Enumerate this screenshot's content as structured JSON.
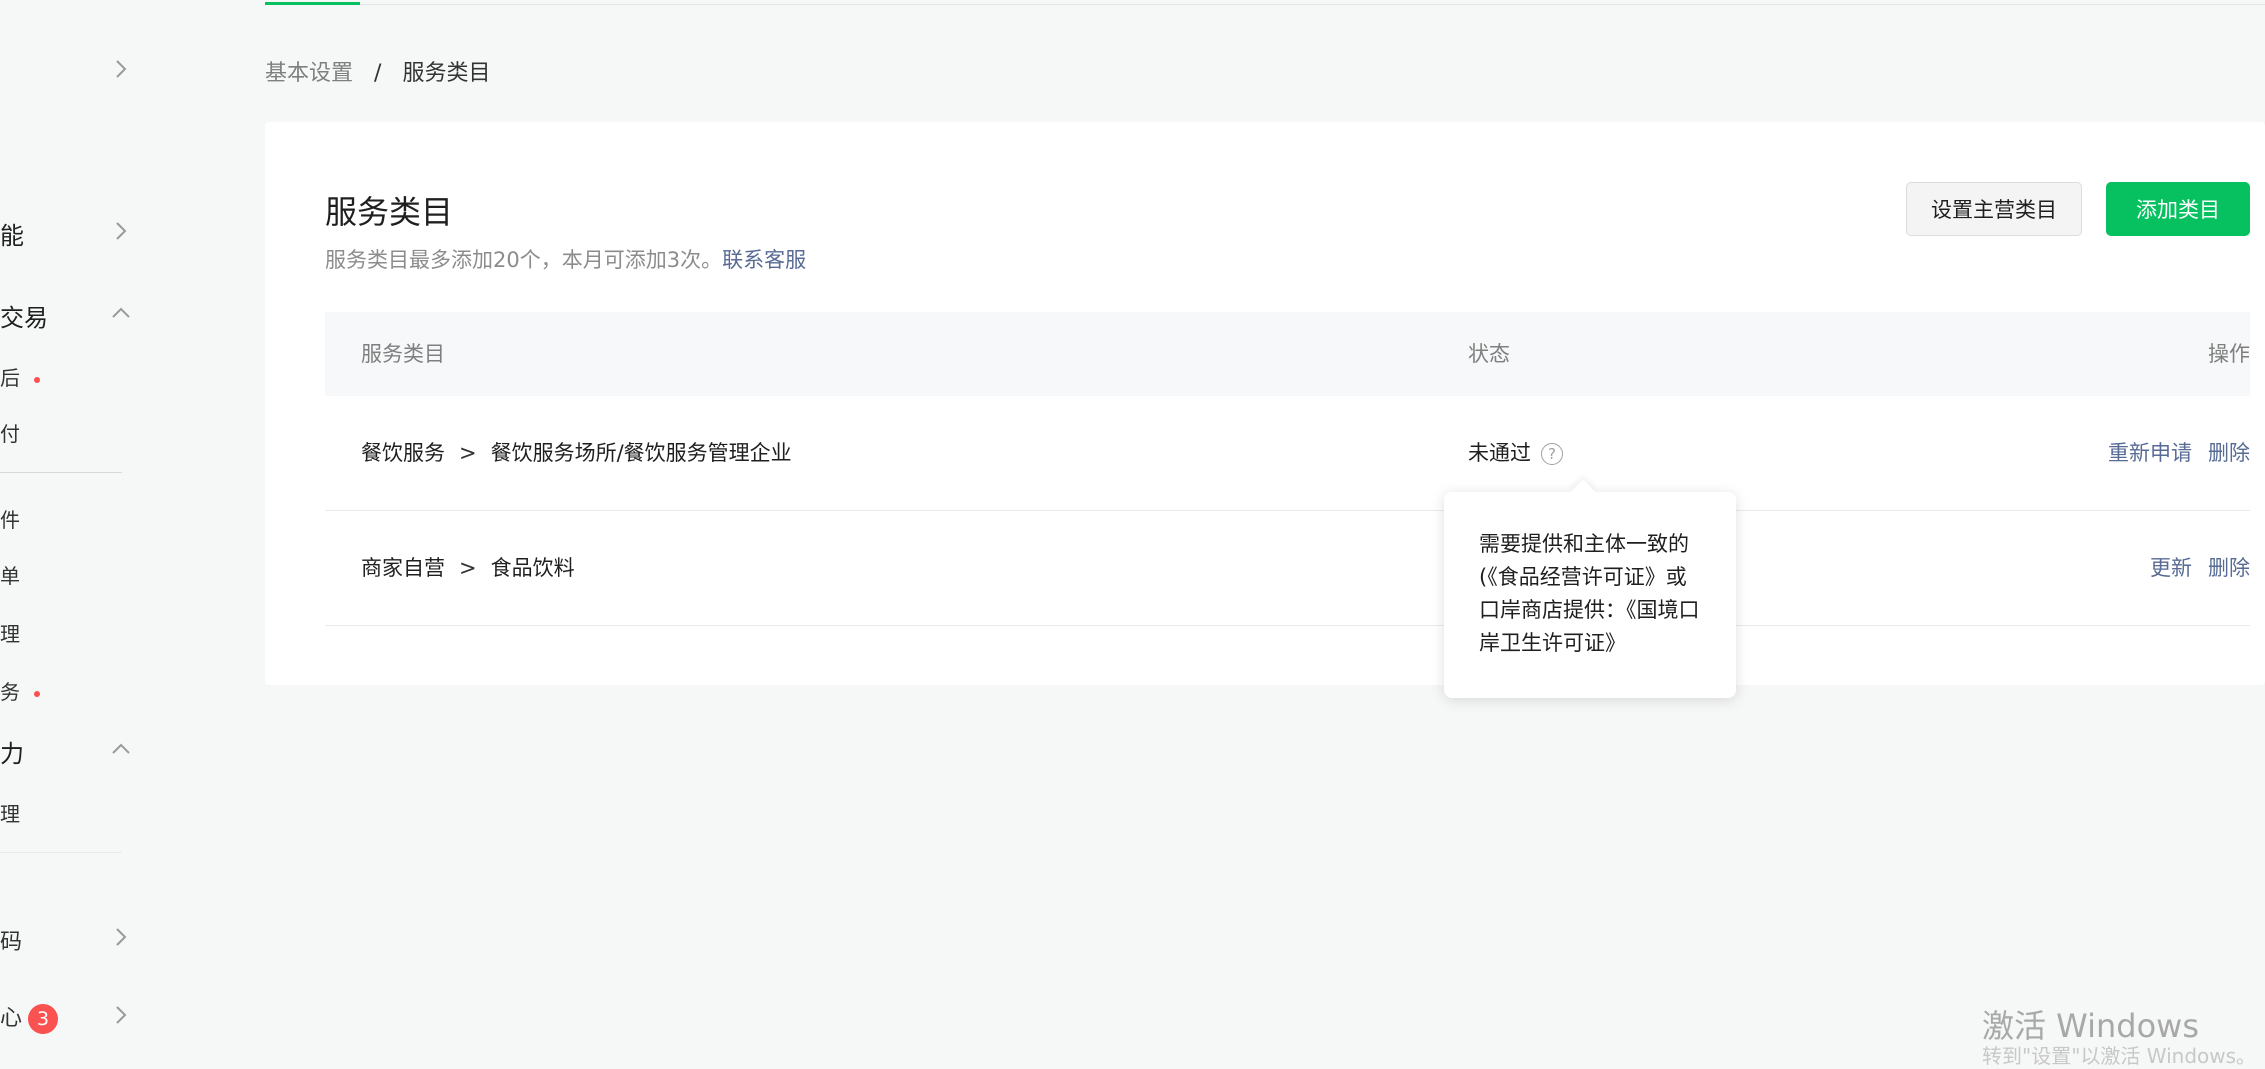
{
  "sidebar": {
    "items": [
      {
        "label": "能",
        "chevron": "up"
      },
      {
        "label": "交易",
        "chevron": "down"
      },
      {
        "label": "力",
        "chevron": "down"
      },
      {
        "label": "码",
        "chevron": "right"
      },
      {
        "label": "心",
        "chevron": "right",
        "badge": "3"
      }
    ],
    "sub_items": [
      "后",
      "付",
      "件",
      "单",
      "理",
      "务",
      "理"
    ]
  },
  "breadcrumb": {
    "parent": "基本设置",
    "separator": "/",
    "current": "服务类目"
  },
  "card": {
    "title": "服务类目",
    "description": "服务类目最多添加20个，本月可添加3次。",
    "contact_link": "联系客服",
    "buttons": {
      "set_main": "设置主营类目",
      "add": "添加类目"
    }
  },
  "table": {
    "headers": {
      "category": "服务类目",
      "status": "状态",
      "actions": "操作"
    },
    "rows": [
      {
        "category_parent": "餐饮服务",
        "separator": ">",
        "category_child": "餐饮服务场所/餐饮服务管理企业",
        "status": "未通过",
        "help_icon": "question-circle-icon",
        "actions": [
          "重新申请",
          "删除"
        ]
      },
      {
        "category_parent": "商家自营",
        "separator": ">",
        "category_child": "食品饮料",
        "status": "",
        "actions": [
          "更新",
          "删除"
        ]
      }
    ]
  },
  "tooltip": {
    "text": "需要提供和主体一致的(《食品经营许可证》或口岸商店提供：《国境口岸卫生许可证》"
  },
  "watermark": {
    "title": "激活 Windows",
    "subtitle": "转到\"设置\"以激活 Windows。"
  },
  "colors": {
    "primary": "#07c160",
    "link": "#576b95",
    "badge": "#fa5151",
    "background": "#f6f7f7"
  }
}
